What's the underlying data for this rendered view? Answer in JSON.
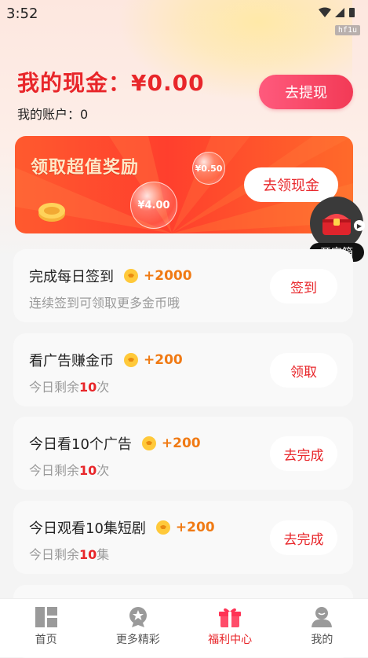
{
  "status_bar": {
    "time": "3:52",
    "badge": "hf1u"
  },
  "wallet": {
    "title": "我的现金：¥0.00",
    "account": "我的账户：0",
    "withdraw_label": "去提现"
  },
  "promo": {
    "title": "领取超值奖励",
    "bubble_large": "¥4.00",
    "bubble_small": "¥0.50",
    "button_label": "去领现金"
  },
  "treasure": {
    "label": "开宝箱"
  },
  "tasks": [
    {
      "title": "完成每日签到",
      "reward": "+2000",
      "sub": "连续签到可领取更多金币哦",
      "button": "签到"
    },
    {
      "title": "看广告赚金币",
      "reward": "+200",
      "sub_prefix": "今日剩余",
      "sub_count": "10",
      "sub_suffix": "次",
      "button": "领取"
    },
    {
      "title": "今日看10个广告",
      "reward": "+200",
      "sub_prefix": "今日剩余",
      "sub_count": "10",
      "sub_suffix": "次",
      "button": "去完成"
    },
    {
      "title": "今日观看10集短剧",
      "reward": "+200",
      "sub_prefix": "今日剩余",
      "sub_count": "10",
      "sub_suffix": "集",
      "button": "去完成"
    }
  ],
  "tabbar": {
    "items": [
      {
        "label": "首页",
        "icon": "home-grid-icon",
        "active": false
      },
      {
        "label": "更多精彩",
        "icon": "star-badge-icon",
        "active": false
      },
      {
        "label": "福利中心",
        "icon": "gift-icon",
        "active": true
      },
      {
        "label": "我的",
        "icon": "user-icon",
        "active": false
      }
    ]
  },
  "colors": {
    "accent": "#e8262a",
    "reward": "#f07a14",
    "banner": "#ff4a2d"
  }
}
